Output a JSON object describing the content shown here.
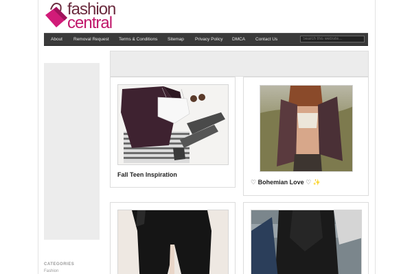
{
  "logo": {
    "line1": "fashion",
    "line2": "central"
  },
  "nav": {
    "items": [
      {
        "label": "About"
      },
      {
        "label": "Removal Request"
      },
      {
        "label": "Terms & Conditions"
      },
      {
        "label": "Sitemap"
      },
      {
        "label": "Privacy Policy"
      },
      {
        "label": "DMCA"
      },
      {
        "label": "Contact Us"
      }
    ],
    "search_placeholder": "Search this website..."
  },
  "sidebar": {
    "categories_heading": "CATEGORIES",
    "first_category": "Fashion"
  },
  "posts": [
    {
      "title": "Fall Teen Inspiration",
      "icon": "sweater-outfit-photo"
    },
    {
      "title_prefix": "♡",
      "title": "Bohemian Love",
      "title_suffix": "♡",
      "title_spark": "✨",
      "icon": "bohemian-photo"
    },
    {
      "title": "",
      "icon": "black-pants-photo"
    },
    {
      "title": "",
      "icon": "fur-vest-photo"
    }
  ],
  "colors": {
    "brand": "#c0176a",
    "nav_bg": "#3a3a3a"
  }
}
